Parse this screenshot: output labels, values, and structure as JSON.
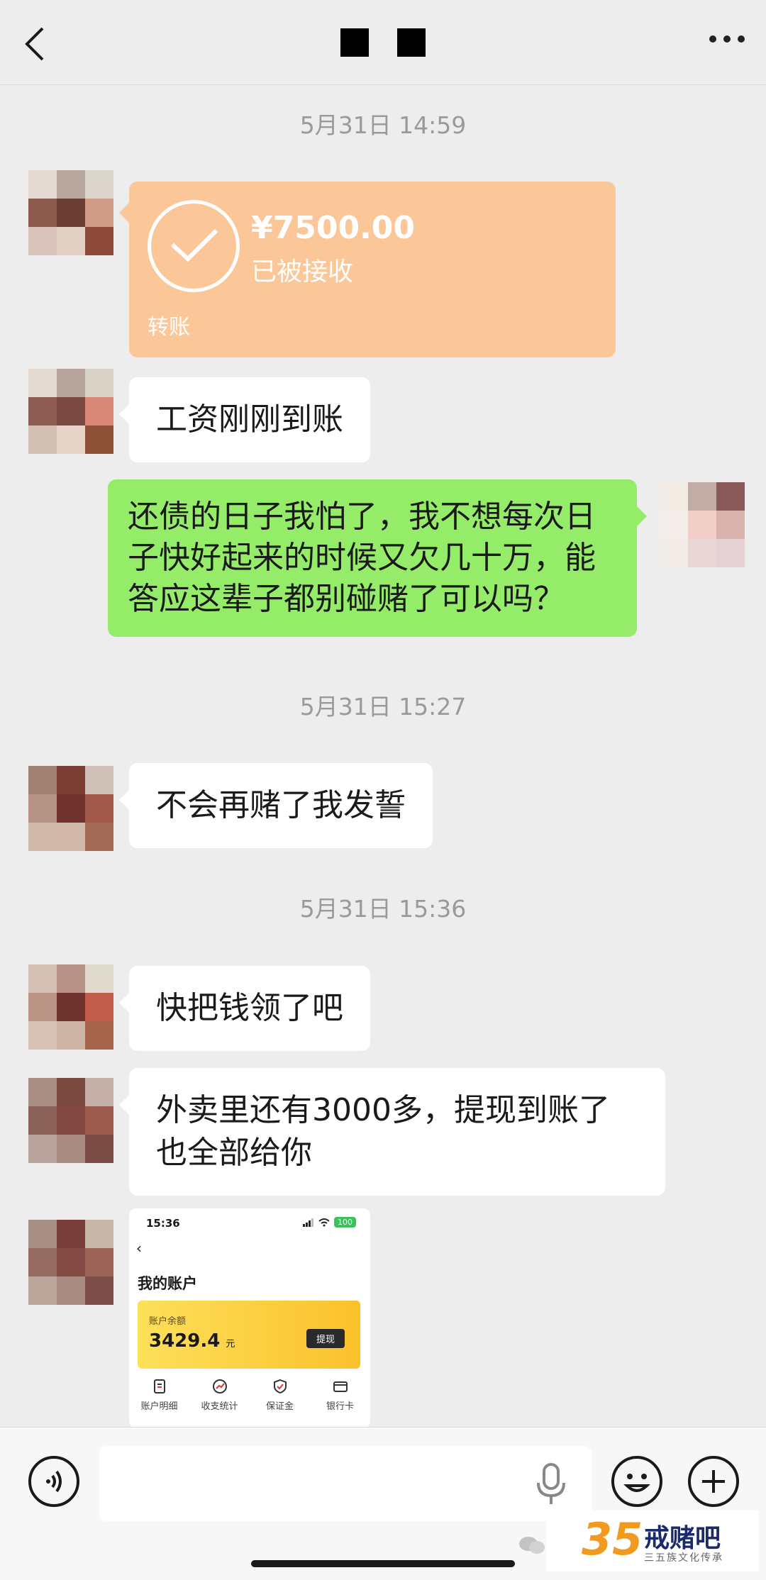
{
  "header": {
    "title": "",
    "back_icon": "chevron-left-icon",
    "more_icon": "more-dots-icon"
  },
  "timestamps": [
    "5月31日 14:59",
    "5月31日 15:27",
    "5月31日 15:36"
  ],
  "transfer": {
    "amount": "¥7500.00",
    "status": "已被接收",
    "label": "转账"
  },
  "messages": {
    "m1": "工资刚刚到账",
    "m2_line1": "还债的日子我怕了，我不想每次日",
    "m2_line2": "子快好起来的时候又欠几十万，能",
    "m2_line3": "答应这辈子都别碰赌了可以吗？",
    "m3": "不会再赌了我发誓",
    "m4": "快把钱领了吧",
    "m5_line1": "外卖里还有3000多，提现到账了",
    "m5_line2": "也全部给你"
  },
  "screenshot": {
    "time": "15:36",
    "battery": "100",
    "title": "我的账户",
    "balance_label": "账户余额",
    "balance": "3429.4",
    "balance_unit": "元",
    "withdraw": "提现",
    "menu": [
      "账户明细",
      "收支统计",
      "保证金",
      "银行卡"
    ]
  },
  "input": {
    "placeholder": ""
  },
  "watermark": {
    "number": "35",
    "name": "戒赌吧",
    "sub": "三五族文化传承"
  },
  "colors": {
    "me_bubble": "#95ec69",
    "transfer": "#fcc798",
    "background": "#ededed"
  }
}
